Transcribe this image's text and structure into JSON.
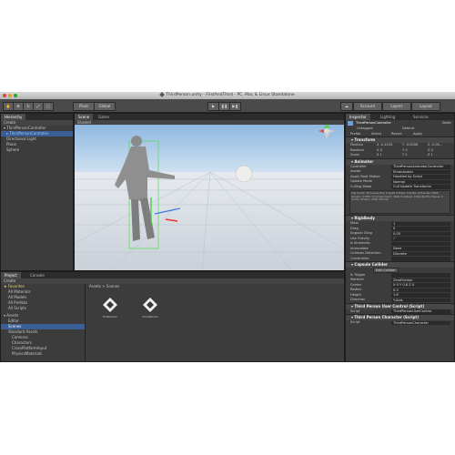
{
  "window": {
    "title": "ThirdPerson.unity - FirstAndThird - PC, Mac & Linux Standalone"
  },
  "toolbar": {
    "pivot": "Pivot",
    "global": "Global",
    "account": "Account",
    "layers": "Layers",
    "layout": "Layout"
  },
  "hierarchy": {
    "tab": "Hierarchy",
    "create": "Create",
    "items": [
      "ThirdPersonController",
      "ThirdPersonController",
      "Directional Light",
      "Plane",
      "Sphere"
    ]
  },
  "scene": {
    "tabs": [
      "Scene",
      "Game"
    ],
    "shading": "Shaded",
    "persp": "Persp"
  },
  "project": {
    "tabs": [
      "Project",
      "Console"
    ],
    "create": "Create",
    "favorites": [
      "Favorites",
      "All Materials",
      "All Models",
      "All Prefabs",
      "All Scripts"
    ],
    "assets": [
      "Assets",
      "Editor",
      "Scenes",
      "Standard Assets",
      "Cameras",
      "Characters",
      "CrossPlatformInput",
      "PhysicsMaterials"
    ],
    "breadcrumb": "Assets > Scenes",
    "files": [
      "FirstPerson",
      "ThirdPerson"
    ]
  },
  "inspector": {
    "tabs": [
      "Inspector",
      "Lighting",
      "Services"
    ],
    "object_name": "ThirdPersonController",
    "tag": "Untagged",
    "layer": "Default",
    "static": "Static",
    "prefab": "Prefab",
    "select": "Select",
    "revert": "Revert",
    "apply": "Apply",
    "transform": {
      "title": "Transform",
      "position": {
        "label": "Position",
        "x": "X -0.4235",
        "y": "Y -0.0008",
        "z": "Z -0.00..."
      },
      "rotation": {
        "label": "Rotation",
        "x": "X 0",
        "y": "Y 0",
        "z": "Z 0"
      },
      "scale": {
        "label": "Scale",
        "x": "X 1",
        "y": "Y 1",
        "z": "Z 1"
      }
    },
    "animator": {
      "title": "Animator",
      "rows": [
        {
          "label": "Controller",
          "value": "ThirdPersonAnimatorController"
        },
        {
          "label": "Avatar",
          "value": "EthanAvatar"
        },
        {
          "label": "Apply Root Motion",
          "value": "Handled by Script"
        },
        {
          "label": "Update Mode",
          "value": "Normal"
        },
        {
          "label": "Culling Mode",
          "value": "Cull Update Transforms"
        }
      ],
      "info": "Clip Count: 30  Curves Pos: 0 Quat: 0 Euler: 0 Scale: 0 Muscles: 3900 Generic: 0 PPtr: 0  Curves Count: 3900 Constant: 1590 (40.8%) Dense: 0 (0.0%) Stream: 2310 (59.2%)"
    },
    "rigidbody": {
      "title": "Rigidbody",
      "rows": [
        {
          "label": "Mass",
          "value": "1"
        },
        {
          "label": "Drag",
          "value": "0"
        },
        {
          "label": "Angular Drag",
          "value": "0.05"
        },
        {
          "label": "Use Gravity",
          "value": "✓"
        },
        {
          "label": "Is Kinematic",
          "value": ""
        },
        {
          "label": "Interpolate",
          "value": "None"
        },
        {
          "label": "Collision Detection",
          "value": "Discrete"
        },
        {
          "label": "Constraints",
          "value": ""
        }
      ]
    },
    "capsule": {
      "title": "Capsule Collider",
      "edit_label": "Edit Collider",
      "rows": [
        {
          "label": "Is Trigger",
          "value": ""
        },
        {
          "label": "Material",
          "value": "ZeroFriction"
        },
        {
          "label": "Center",
          "value": "X 0   Y 0.8   Z 0"
        },
        {
          "label": "Radius",
          "value": "0.3"
        },
        {
          "label": "Height",
          "value": "1.6"
        },
        {
          "label": "Direction",
          "value": "Y-Axis"
        }
      ]
    },
    "user_control": {
      "title": "Third Person User Control (Script)",
      "script_label": "Script",
      "script_value": "ThirdPersonUserControl"
    },
    "character": {
      "title": "Third Person Character (Script)",
      "script_label": "Script",
      "script_value": "ThirdPersonCharacter"
    }
  },
  "colors": {
    "ui_bg": "#383838",
    "selection": "#3a5f95",
    "sky": "#9fc3e8",
    "ground": "#d7dde4"
  }
}
